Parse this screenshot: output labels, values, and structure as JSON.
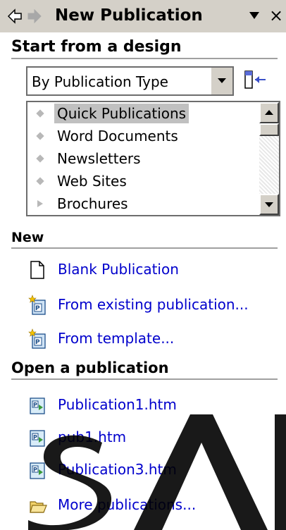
{
  "titlebar": {
    "title": "New Publication",
    "close_glyph": "×"
  },
  "start": {
    "heading": "Start from a design",
    "dropdown_value": "By Publication Type",
    "list": [
      {
        "label": "Quick Publications",
        "selected": true,
        "bullet": "diamond"
      },
      {
        "label": "Word Documents",
        "bullet": "diamond"
      },
      {
        "label": "Newsletters",
        "bullet": "diamond"
      },
      {
        "label": "Web Sites",
        "bullet": "diamond"
      },
      {
        "label": "Brochures",
        "bullet": "triangle"
      }
    ]
  },
  "new": {
    "heading": "New",
    "links": [
      {
        "label": "Blank Publication",
        "icon": "blank-page-icon"
      },
      {
        "label": "From existing publication...",
        "icon": "publisher-wizard-icon"
      },
      {
        "label": "From template...",
        "icon": "publisher-wizard-icon"
      }
    ]
  },
  "open": {
    "heading": "Open a publication",
    "links": [
      {
        "label": "Publication1.htm",
        "icon": "publisher-file-icon"
      },
      {
        "label": "pub1.htm",
        "icon": "publisher-file-icon"
      },
      {
        "label": "Publication3.htm",
        "icon": "publisher-file-icon"
      },
      {
        "label": "More publications...",
        "icon": "open-folder-icon"
      }
    ]
  },
  "colors": {
    "link": "#0000cc",
    "panel": "#d4d0c8",
    "selection": "#c0c0c0"
  }
}
